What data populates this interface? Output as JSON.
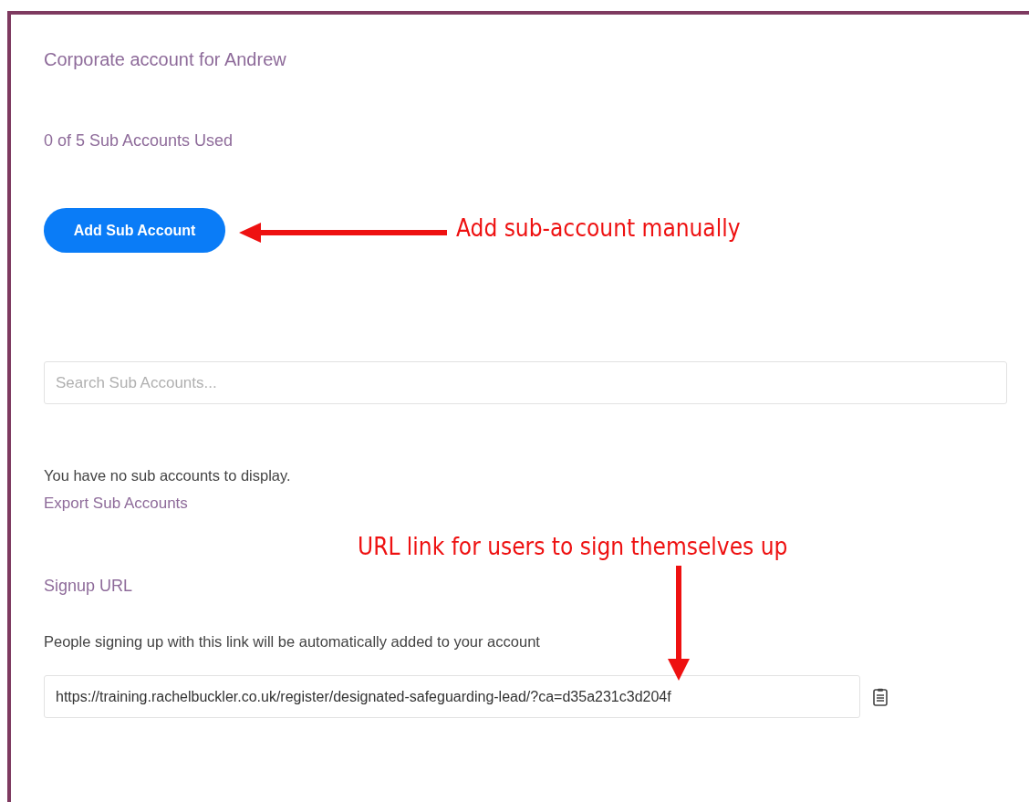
{
  "account_title": "Corporate account for Andrew",
  "usage": "0 of 5 Sub Accounts Used",
  "add_button": "Add Sub Account",
  "search": {
    "placeholder": "Search Sub Accounts..."
  },
  "empty_message": "You have no sub accounts to display.",
  "export_link": "Export Sub Accounts",
  "signup": {
    "heading": "Signup URL",
    "description": "People signing up with this link will be automatically added to your account",
    "url": "https://training.rachelbuckler.co.uk/register/designated-safeguarding-lead/?ca=d35a231c3d204f"
  },
  "annotations": [
    {
      "kind": "left",
      "text": "Add sub-account manually"
    },
    {
      "kind": "down",
      "text": "URL link for users to sign themselves up"
    }
  ]
}
